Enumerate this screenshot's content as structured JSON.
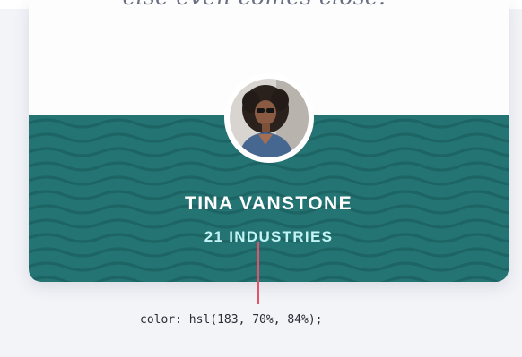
{
  "testimonial": {
    "quote_text": "else even comes close.",
    "quote_mark": "””",
    "author_name": "TINA VANSTONE",
    "author_company": "21 INDUSTRIES",
    "avatar": "profile-photo"
  },
  "annotation": {
    "text": "color: hsl(183, 70%, 84%);"
  },
  "colors": {
    "teal_background": "#247473",
    "company_text": "#c2f3f5",
    "pointer_line": "#e0556a",
    "page_background": "#f3f4f8"
  }
}
